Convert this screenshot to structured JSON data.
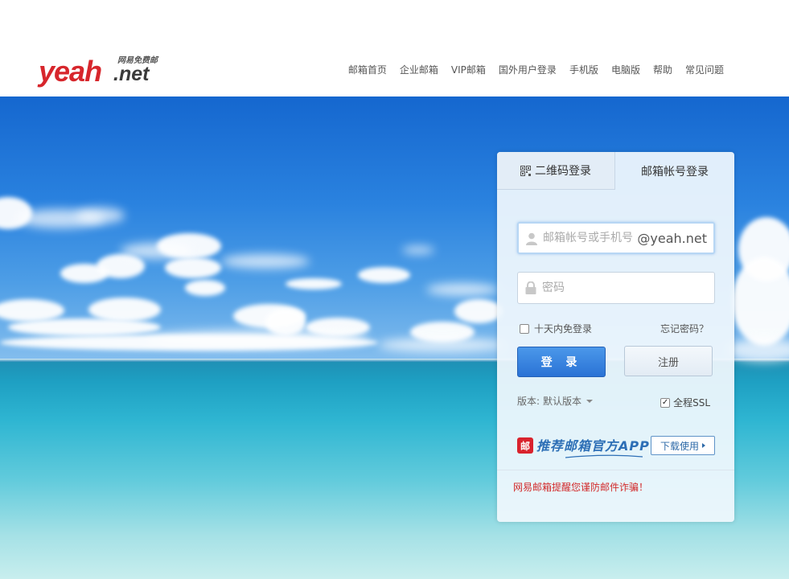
{
  "header": {
    "logo_main": "yeah",
    "logo_suffix": ".net",
    "logo_tagline": "网易免费邮",
    "nav": [
      {
        "label": "邮箱首页"
      },
      {
        "label": "企业邮箱"
      },
      {
        "label": "VIP邮箱"
      },
      {
        "label": "国外用户登录"
      },
      {
        "label": "手机版"
      },
      {
        "label": "电脑版"
      },
      {
        "label": "帮助"
      },
      {
        "label": "常见问题"
      }
    ]
  },
  "login": {
    "tabs": {
      "qr": "二维码登录",
      "account": "邮箱帐号登录"
    },
    "username": {
      "placeholder": "邮箱帐号或手机号",
      "domain_suffix": "@yeah.net"
    },
    "password": {
      "placeholder": "密码"
    },
    "remember_label": "十天内免登录",
    "forgot_label": "忘记密码？",
    "login_button": "登 录",
    "register_button": "注册",
    "version_prefix": "版本:",
    "version_value": "默认版本",
    "ssl_label": "全程SSL",
    "ssl_checked": true,
    "app_promo": "推荐邮箱官方APP",
    "app_logo_glyph": "邮",
    "download_button": "下载使用",
    "warning": "网易邮箱提醒您谨防邮件诈骗！"
  },
  "icons": {
    "qr": "qr-code-icon",
    "user": "user-icon",
    "lock": "lock-icon"
  },
  "colors": {
    "brand_red": "#d7262c",
    "login_blue": "#2a72d5",
    "warning_red": "#d22a2a"
  }
}
